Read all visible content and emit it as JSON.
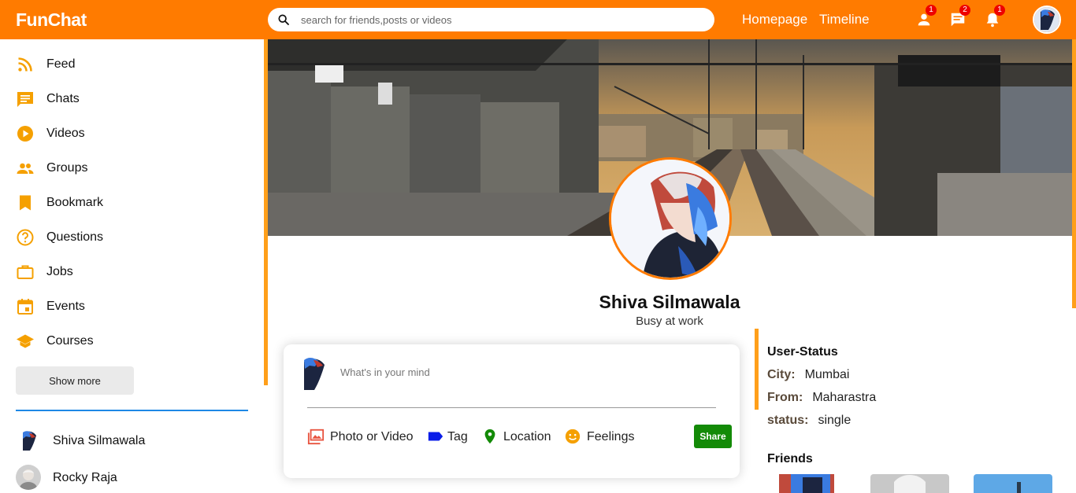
{
  "app": {
    "logo": "FunChat"
  },
  "search": {
    "placeholder": "search for friends,posts or videos"
  },
  "nav": {
    "homepage": "Homepage",
    "timeline": "Timeline"
  },
  "notifications": {
    "friend_requests": "1",
    "messages": "2",
    "alerts": "1"
  },
  "sidebar": {
    "items": [
      {
        "label": "Feed",
        "icon": "rss-feed-icon"
      },
      {
        "label": "Chats",
        "icon": "chat-icon"
      },
      {
        "label": "Videos",
        "icon": "play-circle-icon"
      },
      {
        "label": "Groups",
        "icon": "group-icon"
      },
      {
        "label": "Bookmark",
        "icon": "bookmark-icon"
      },
      {
        "label": "Questions",
        "icon": "help-icon"
      },
      {
        "label": "Jobs",
        "icon": "briefcase-icon"
      },
      {
        "label": "Events",
        "icon": "calendar-icon"
      },
      {
        "label": "Courses",
        "icon": "school-icon"
      }
    ],
    "show_more": "Show more",
    "friends": [
      {
        "name": "Shiva Silmawala"
      },
      {
        "name": "Rocky Raja"
      }
    ]
  },
  "profile": {
    "name": "Shiva Silmawala",
    "description": "Busy at work"
  },
  "share": {
    "placeholder": "What's in your mind",
    "options": [
      {
        "label": "Photo or Video",
        "icon": "photo-library-icon"
      },
      {
        "label": "Tag",
        "icon": "label-icon"
      },
      {
        "label": "Location",
        "icon": "location-pin-icon"
      },
      {
        "label": "Feelings",
        "icon": "smiley-icon"
      }
    ],
    "button": "Share"
  },
  "user_status": {
    "title": "User-Status",
    "city_label": "City:",
    "city": "Mumbai",
    "from_label": "From:",
    "from": "Maharastra",
    "status_label": "status:",
    "status": "single",
    "friends_title": "Friends"
  },
  "colors": {
    "brand": "#ff7b00",
    "accent": "#ff9f1a",
    "icon": "#f5a000",
    "share_button": "#138a07",
    "badge": "#e00000",
    "divider": "#1e88e5"
  }
}
